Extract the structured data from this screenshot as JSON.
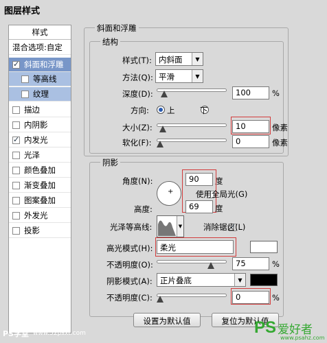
{
  "window": {
    "title": "图层样式"
  },
  "sidebar": {
    "header": "样式",
    "blend": "混合选项:自定",
    "items": [
      {
        "label": "斜面和浮雕",
        "checked": true
      },
      {
        "label": "等高线",
        "checked": false
      },
      {
        "label": "纹理",
        "checked": false
      },
      {
        "label": "描边",
        "checked": false
      },
      {
        "label": "内阴影",
        "checked": false
      },
      {
        "label": "内发光",
        "checked": true
      },
      {
        "label": "光泽",
        "checked": false
      },
      {
        "label": "颜色叠加",
        "checked": false
      },
      {
        "label": "渐变叠加",
        "checked": false
      },
      {
        "label": "图案叠加",
        "checked": false
      },
      {
        "label": "外发光",
        "checked": false
      },
      {
        "label": "投影",
        "checked": false
      }
    ]
  },
  "bevel": {
    "section": "斜面和浮雕",
    "structure": "结构",
    "style_label": "样式(T):",
    "style_value": "内斜面",
    "technique_label": "方法(Q):",
    "technique_value": "平滑",
    "depth_label": "深度(D):",
    "depth_value": "100",
    "depth_unit": "%",
    "depth_pct": 0.1,
    "direction_label": "方向:",
    "dir_up": "上",
    "dir_down": "下",
    "size_label": "大小(Z):",
    "size_value": "10",
    "size_unit": "像素",
    "size_pct": 0.05,
    "soften_label": "软化(F):",
    "soften_value": "0",
    "soften_unit": "像素",
    "soften_pct": 0
  },
  "shading": {
    "section": "阴影",
    "angle_label": "角度(N):",
    "angle_value": "90",
    "angle_unit": "度",
    "global_light_label": "使用全局光(G)",
    "altitude_label": "高度:",
    "altitude_value": "69",
    "altitude_unit": "度",
    "gloss_label": "光泽等高线:",
    "antialias_label": "消除锯齿(L)",
    "highlight_mode_label": "高光模式(H):",
    "highlight_mode_value": "柔光",
    "highlight_color": "#ffffff",
    "highlight_opacity_label": "不透明度(O):",
    "highlight_opacity_value": "75",
    "highlight_opacity_pct": 0.75,
    "pct": "%",
    "shadow_mode_label": "阴影模式(A):",
    "shadow_mode_value": "正片叠底",
    "shadow_color": "#000000",
    "shadow_opacity_label": "不透明度(C):",
    "shadow_opacity_value": "0",
    "shadow_opacity_pct": 0
  },
  "buttons": {
    "default_set": "设置为默认值",
    "default_reset": "复位为默认值"
  },
  "watermarks": {
    "left": "PS学堂",
    "url": "www.52psxt.com",
    "right_ps": "PS",
    "right_text": "爱好者",
    "right_url": "www.psahz.com"
  }
}
